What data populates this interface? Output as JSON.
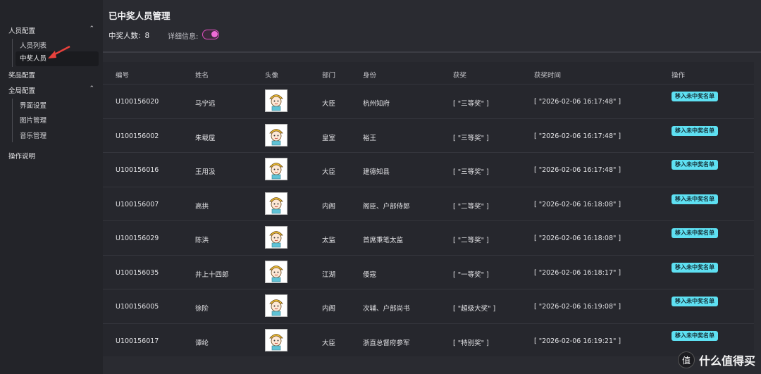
{
  "sidebar": {
    "group_people": "人员配置",
    "people_items": [
      "人员列表",
      "中奖人员"
    ],
    "prize_config": "奖品配置",
    "group_global": "全局配置",
    "global_items": [
      "界面设置",
      "图片管理",
      "音乐管理"
    ],
    "help": "操作说明",
    "chevron": "⌃"
  },
  "main": {
    "title": "已中奖人员管理",
    "winner_count_label": "中奖人数:",
    "winner_count": "8",
    "detail_label": "详细信息:",
    "detail_toggle_on": true
  },
  "table": {
    "columns": [
      "编号",
      "姓名",
      "头像",
      "部门",
      "身份",
      "获奖",
      "获奖时间",
      "操作"
    ],
    "action_label": "移入未中奖名单",
    "rows": [
      {
        "id": "U100156020",
        "name": "马宁远",
        "dept": "大臣",
        "role": "杭州知府",
        "prize": "[ \"三等奖\" ]",
        "time": "[ \"2026-02-06 16:17:48\" ]"
      },
      {
        "id": "U100156002",
        "name": "朱载垕",
        "dept": "皇室",
        "role": "裕王",
        "prize": "[ \"三等奖\" ]",
        "time": "[ \"2026-02-06 16:17:48\" ]"
      },
      {
        "id": "U100156016",
        "name": "王用汲",
        "dept": "大臣",
        "role": "建德知县",
        "prize": "[ \"三等奖\" ]",
        "time": "[ \"2026-02-06 16:17:48\" ]"
      },
      {
        "id": "U100156007",
        "name": "高拱",
        "dept": "内阁",
        "role": "阁臣、户部侍郎",
        "prize": "[ \"二等奖\" ]",
        "time": "[ \"2026-02-06 16:18:08\" ]"
      },
      {
        "id": "U100156029",
        "name": "陈洪",
        "dept": "太监",
        "role": "首席秉笔太监",
        "prize": "[ \"二等奖\" ]",
        "time": "[ \"2026-02-06 16:18:08\" ]"
      },
      {
        "id": "U100156035",
        "name": "井上十四郎",
        "dept": "江湖",
        "role": "倭寇",
        "prize": "[ \"一等奖\" ]",
        "time": "[ \"2026-02-06 16:18:17\" ]"
      },
      {
        "id": "U100156005",
        "name": "徐阶",
        "dept": "内阁",
        "role": "次辅、户部尚书",
        "prize": "[ \"超级大奖\" ]",
        "time": "[ \"2026-02-06 16:19:08\" ]"
      },
      {
        "id": "U100156017",
        "name": "谭纶",
        "dept": "大臣",
        "role": "浙直总督府参军",
        "prize": "[ \"特别奖\" ]",
        "time": "[ \"2026-02-06 16:19:21\" ]"
      }
    ]
  },
  "watermark": {
    "glyph": "值",
    "text": "什么值得买"
  },
  "colors": {
    "accent_toggle": "#ee6bd6",
    "action_button": "#5ee0f2",
    "arrow": "#e8413c"
  }
}
